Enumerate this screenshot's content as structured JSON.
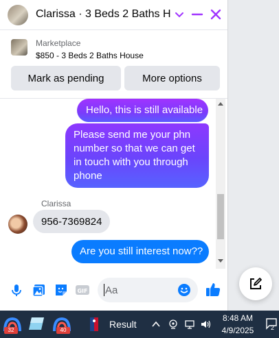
{
  "header": {
    "title": "Clarissa · 3 Beds 2 Baths H...",
    "accent": "#a033ff"
  },
  "listing": {
    "source": "Marketplace",
    "price_title": "$850 - 3 Beds 2 Baths House",
    "buttons": [
      "Mark as pending",
      "More options"
    ]
  },
  "messages": {
    "outgoing_1": "Hello, this is still available",
    "outgoing_2": "Please send me your phn number so that we can get in touch with you through phone",
    "sender": "Clarissa",
    "incoming_1": "956-7369824",
    "outgoing_3": "Are you still interest now??"
  },
  "composer": {
    "placeholder": "Aa",
    "icons": [
      "microphone-icon",
      "image-icon",
      "sticker-icon",
      "gif-icon",
      "emoji-icon",
      "thumbs-up-icon"
    ]
  },
  "fab": {
    "icon": "new-message-icon"
  },
  "taskbar": {
    "badges": [
      "32",
      "40"
    ],
    "result_label": "Result",
    "time": "8:48 AM",
    "date": "4/9/2025",
    "notification_count": "2"
  }
}
